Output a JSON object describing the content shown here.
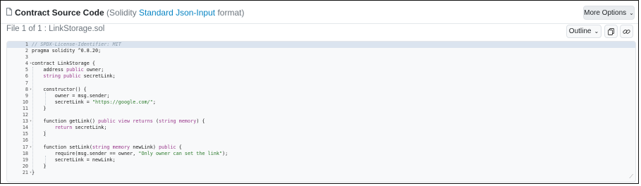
{
  "header": {
    "title_bold": "Contract Source Code",
    "title_pre": "(Solidity ",
    "title_link": "Standard Json-Input",
    "title_post": " format)",
    "more_options": "More Options"
  },
  "file": {
    "label": "File 1 of 1 : LinkStorage.sol",
    "outline": "Outline"
  },
  "icons": [
    "document-icon",
    "chevron-down-icon",
    "copy-icon",
    "link-icon"
  ],
  "colors": {
    "link": "#0784c3",
    "keyword": "#9a3a8c",
    "string": "#2b7a2b",
    "comment": "#8a9aa8"
  },
  "lines": [
    {
      "n": "1",
      "fold": "",
      "code": "// SPDX-License-Identifier: MIT"
    },
    {
      "n": "2",
      "fold": "",
      "code": "pragma solidity ^0.8.20;"
    },
    {
      "n": "3",
      "fold": "",
      "code": ""
    },
    {
      "n": "4",
      "fold": "▾",
      "code": "contract LinkStorage {"
    },
    {
      "n": "5",
      "fold": "",
      "code": "    address public owner;"
    },
    {
      "n": "6",
      "fold": "",
      "code": "    string public secretLink;"
    },
    {
      "n": "7",
      "fold": "",
      "code": ""
    },
    {
      "n": "8",
      "fold": "▾",
      "code": "    constructor() {"
    },
    {
      "n": "9",
      "fold": "",
      "code": "        owner = msg.sender;"
    },
    {
      "n": "10",
      "fold": "",
      "code": "        secretLink = \"https://google.com/\";"
    },
    {
      "n": "11",
      "fold": "",
      "code": "    }"
    },
    {
      "n": "12",
      "fold": "",
      "code": ""
    },
    {
      "n": "13",
      "fold": "▾",
      "code": "    function getLink() public view returns (string memory) {"
    },
    {
      "n": "14",
      "fold": "",
      "code": "        return secretLink;"
    },
    {
      "n": "15",
      "fold": "",
      "code": "    }"
    },
    {
      "n": "16",
      "fold": "",
      "code": ""
    },
    {
      "n": "17",
      "fold": "▾",
      "code": "    function setLink(string memory newLink) public {"
    },
    {
      "n": "18",
      "fold": "",
      "code": "        require(msg.sender == owner, \"Only owner can set the link\");"
    },
    {
      "n": "19",
      "fold": "",
      "code": "        secretLink = newLink;"
    },
    {
      "n": "20",
      "fold": "",
      "code": "    }"
    },
    {
      "n": "21",
      "fold": "▾",
      "code": "}"
    }
  ]
}
